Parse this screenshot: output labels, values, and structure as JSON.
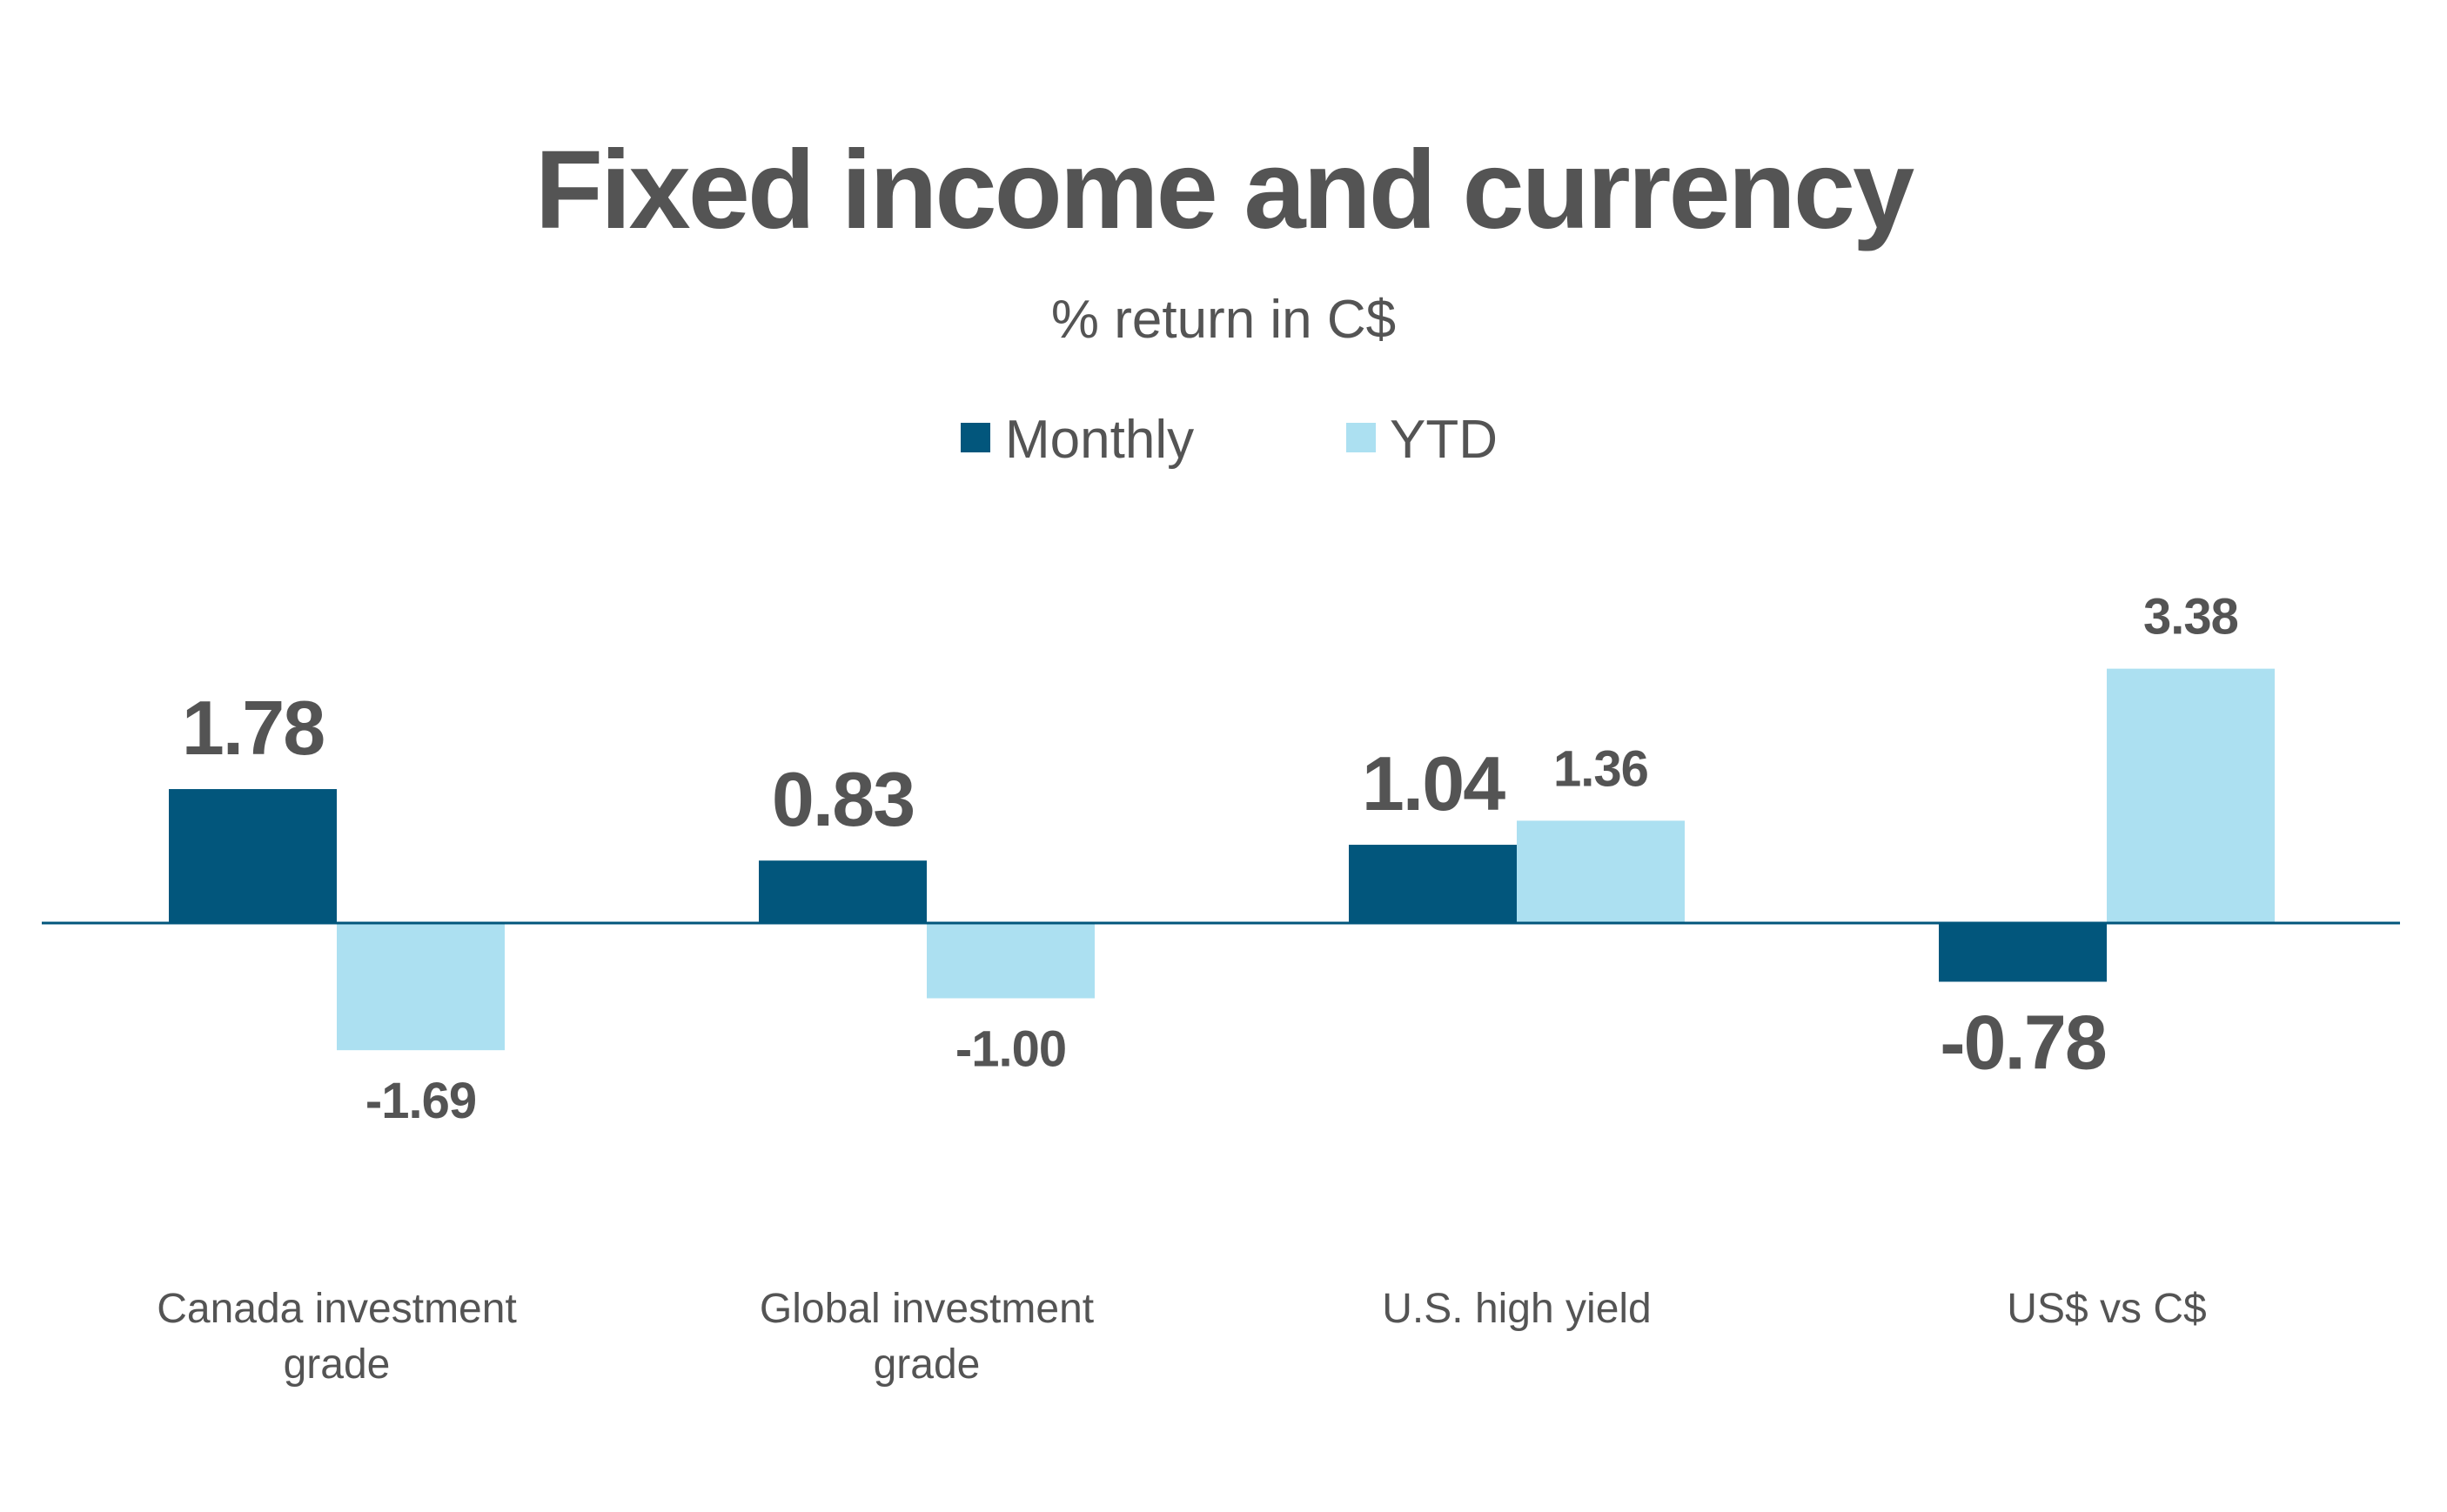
{
  "chart_data": {
    "type": "bar",
    "title": "Fixed income and currency",
    "subtitle": "% return in C$",
    "xlabel": "",
    "ylabel": "",
    "categories": [
      [
        "Canada investment",
        "grade"
      ],
      [
        "Global investment",
        "grade"
      ],
      [
        "U.S. high yield"
      ],
      [
        "US$ vs C$"
      ]
    ],
    "series": [
      {
        "name": "Monthly",
        "color": "#02567C",
        "values": [
          1.78,
          0.83,
          1.04,
          -0.78
        ],
        "labels": [
          "1.78",
          "0.83",
          "1.04",
          "-0.78"
        ]
      },
      {
        "name": "YTD",
        "color": "#ACE0F1",
        "values": [
          -1.69,
          -1.0,
          1.36,
          3.38
        ],
        "labels": [
          "-1.69",
          "-1.00",
          "1.36",
          "3.38"
        ]
      }
    ],
    "ylim": [
      -1.69,
      3.38
    ],
    "grid": false,
    "legend": "top-center",
    "axis_color": "#02567C"
  }
}
